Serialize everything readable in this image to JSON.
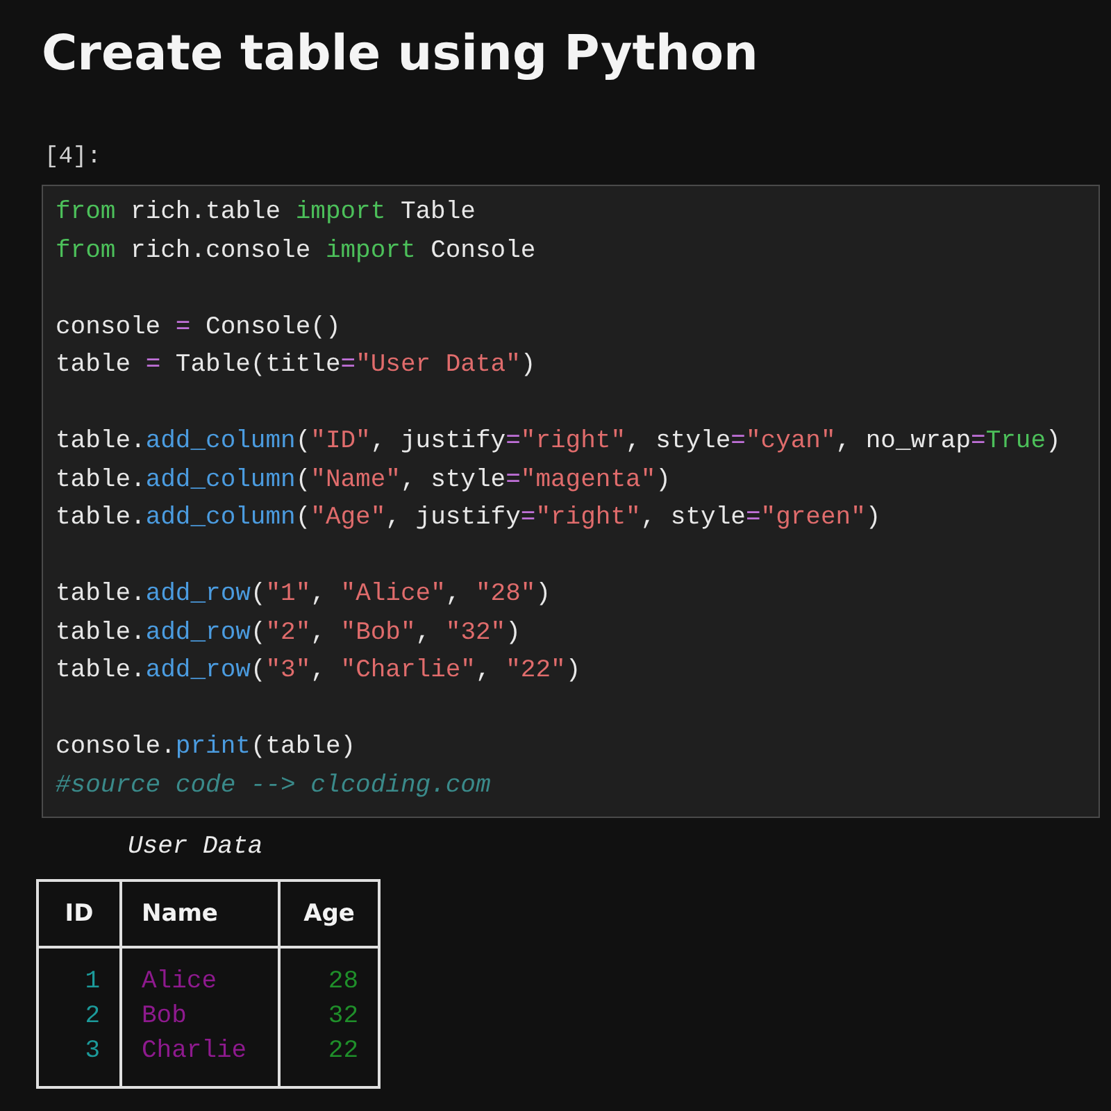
{
  "heading": "Create table using Python",
  "cell": {
    "prompt": "[4]:",
    "lines": [
      {
        "kind": "code",
        "tokens": [
          {
            "kind": "kw",
            "text": "from"
          },
          {
            "kind": "plain",
            "text": " rich.table "
          },
          {
            "kind": "kw",
            "text": "import"
          },
          {
            "kind": "plain",
            "text": " Table"
          }
        ]
      },
      {
        "kind": "code",
        "tokens": [
          {
            "kind": "kw",
            "text": "from"
          },
          {
            "kind": "plain",
            "text": " rich.console "
          },
          {
            "kind": "kw",
            "text": "import"
          },
          {
            "kind": "plain",
            "text": " Console"
          }
        ]
      },
      {
        "kind": "blank"
      },
      {
        "kind": "code",
        "tokens": [
          {
            "kind": "plain",
            "text": "console "
          },
          {
            "kind": "op",
            "text": "="
          },
          {
            "kind": "plain",
            "text": " Console()"
          }
        ]
      },
      {
        "kind": "code",
        "tokens": [
          {
            "kind": "plain",
            "text": "table "
          },
          {
            "kind": "op",
            "text": "="
          },
          {
            "kind": "plain",
            "text": " Table(title"
          },
          {
            "kind": "op",
            "text": "="
          },
          {
            "kind": "str",
            "text": "\"User Data\""
          },
          {
            "kind": "plain",
            "text": ")"
          }
        ]
      },
      {
        "kind": "blank"
      },
      {
        "kind": "code",
        "tokens": [
          {
            "kind": "plain",
            "text": "table."
          },
          {
            "kind": "fn",
            "text": "add_column"
          },
          {
            "kind": "plain",
            "text": "("
          },
          {
            "kind": "str",
            "text": "\"ID\""
          },
          {
            "kind": "plain",
            "text": ", justify"
          },
          {
            "kind": "op",
            "text": "="
          },
          {
            "kind": "str",
            "text": "\"right\""
          },
          {
            "kind": "plain",
            "text": ", style"
          },
          {
            "kind": "op",
            "text": "="
          },
          {
            "kind": "str",
            "text": "\"cyan\""
          },
          {
            "kind": "plain",
            "text": ", no_wrap"
          },
          {
            "kind": "op",
            "text": "="
          },
          {
            "kind": "kw",
            "text": "True"
          },
          {
            "kind": "plain",
            "text": ")"
          }
        ]
      },
      {
        "kind": "code",
        "tokens": [
          {
            "kind": "plain",
            "text": "table."
          },
          {
            "kind": "fn",
            "text": "add_column"
          },
          {
            "kind": "plain",
            "text": "("
          },
          {
            "kind": "str",
            "text": "\"Name\""
          },
          {
            "kind": "plain",
            "text": ", style"
          },
          {
            "kind": "op",
            "text": "="
          },
          {
            "kind": "str",
            "text": "\"magenta\""
          },
          {
            "kind": "plain",
            "text": ")"
          }
        ]
      },
      {
        "kind": "code",
        "tokens": [
          {
            "kind": "plain",
            "text": "table."
          },
          {
            "kind": "fn",
            "text": "add_column"
          },
          {
            "kind": "plain",
            "text": "("
          },
          {
            "kind": "str",
            "text": "\"Age\""
          },
          {
            "kind": "plain",
            "text": ", justify"
          },
          {
            "kind": "op",
            "text": "="
          },
          {
            "kind": "str",
            "text": "\"right\""
          },
          {
            "kind": "plain",
            "text": ", style"
          },
          {
            "kind": "op",
            "text": "="
          },
          {
            "kind": "str",
            "text": "\"green\""
          },
          {
            "kind": "plain",
            "text": ")"
          }
        ]
      },
      {
        "kind": "blank"
      },
      {
        "kind": "code",
        "tokens": [
          {
            "kind": "plain",
            "text": "table."
          },
          {
            "kind": "fn",
            "text": "add_row"
          },
          {
            "kind": "plain",
            "text": "("
          },
          {
            "kind": "str",
            "text": "\"1\""
          },
          {
            "kind": "plain",
            "text": ", "
          },
          {
            "kind": "str",
            "text": "\"Alice\""
          },
          {
            "kind": "plain",
            "text": ", "
          },
          {
            "kind": "str",
            "text": "\"28\""
          },
          {
            "kind": "plain",
            "text": ")"
          }
        ]
      },
      {
        "kind": "code",
        "tokens": [
          {
            "kind": "plain",
            "text": "table."
          },
          {
            "kind": "fn",
            "text": "add_row"
          },
          {
            "kind": "plain",
            "text": "("
          },
          {
            "kind": "str",
            "text": "\"2\""
          },
          {
            "kind": "plain",
            "text": ", "
          },
          {
            "kind": "str",
            "text": "\"Bob\""
          },
          {
            "kind": "plain",
            "text": ", "
          },
          {
            "kind": "str",
            "text": "\"32\""
          },
          {
            "kind": "plain",
            "text": ")"
          }
        ]
      },
      {
        "kind": "code",
        "tokens": [
          {
            "kind": "plain",
            "text": "table."
          },
          {
            "kind": "fn",
            "text": "add_row"
          },
          {
            "kind": "plain",
            "text": "("
          },
          {
            "kind": "str",
            "text": "\"3\""
          },
          {
            "kind": "plain",
            "text": ", "
          },
          {
            "kind": "str",
            "text": "\"Charlie\""
          },
          {
            "kind": "plain",
            "text": ", "
          },
          {
            "kind": "str",
            "text": "\"22\""
          },
          {
            "kind": "plain",
            "text": ")"
          }
        ]
      },
      {
        "kind": "blank"
      },
      {
        "kind": "code",
        "tokens": [
          {
            "kind": "plain",
            "text": "console."
          },
          {
            "kind": "fn",
            "text": "print"
          },
          {
            "kind": "plain",
            "text": "(table)"
          }
        ]
      },
      {
        "kind": "code",
        "tokens": [
          {
            "kind": "comment",
            "text": "#source code --> clcoding.com"
          }
        ]
      }
    ]
  },
  "output": {
    "title": "User Data",
    "columns": [
      {
        "label": "ID",
        "right_aligned": true,
        "color": "#1c9a9a"
      },
      {
        "label": "Name",
        "right_aligned": false,
        "color": "#8e1a8e"
      },
      {
        "label": "Age",
        "right_aligned": true,
        "color": "#1f8f2a"
      }
    ],
    "rows": [
      [
        "1",
        "Alice",
        "28"
      ],
      [
        "2",
        "Bob",
        "32"
      ],
      [
        "3",
        "Charlie",
        "22"
      ]
    ]
  }
}
